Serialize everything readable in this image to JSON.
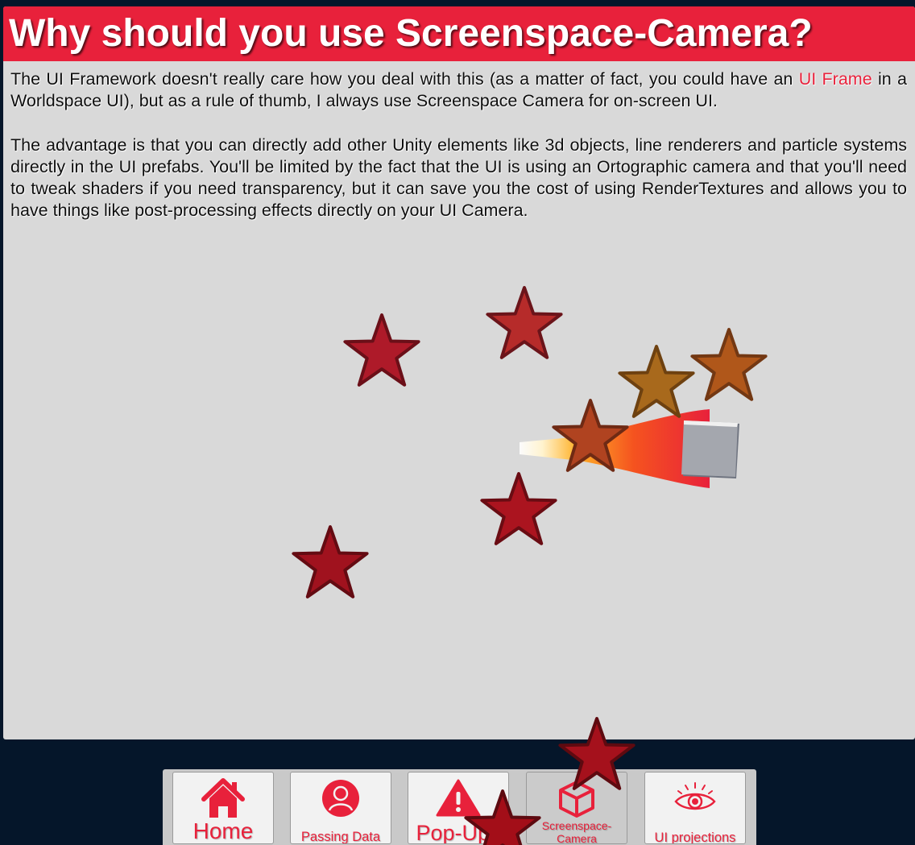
{
  "panel": {
    "title": "Why should you use Screenspace-Camera?",
    "paragraph1": {
      "before_link": "The UI Framework doesn't really care how you deal with this (as a matter of fact, you could have an ",
      "link_text": "UI Frame",
      "after_link": " in a Worldspace UI), but as a rule of thumb, I always use Screenspace Camera for on-screen UI."
    },
    "paragraph2": "The advantage is that you can directly add other Unity elements like 3d objects, line renderers and particle systems directly in the UI prefabs. You'll be limited by the fact that the UI is using an Ortographic camera and that you'll need to tweak shaders if you need transparency, but it can save you the cost of using RenderTextures and allows you to have things like post-processing effects directly on your UI Camera."
  },
  "nav": {
    "items": [
      {
        "label": "Home",
        "icon": "home-icon",
        "active": false
      },
      {
        "label": "Passing Data",
        "icon": "user-icon",
        "active": false
      },
      {
        "label": "Pop-Ups",
        "icon": "warning-icon",
        "active": false
      },
      {
        "label": "Screenspace-\nCamera",
        "icon": "cube-icon",
        "active": true
      },
      {
        "label": "UI projections",
        "icon": "eye-icon",
        "active": false
      }
    ]
  },
  "colors": {
    "accent": "#e8213b",
    "background": "#05162a",
    "panel": "#d9d9d9",
    "star_red": "#a8161e",
    "star_orange": "#b0571a",
    "star_gold": "#a8691c"
  }
}
